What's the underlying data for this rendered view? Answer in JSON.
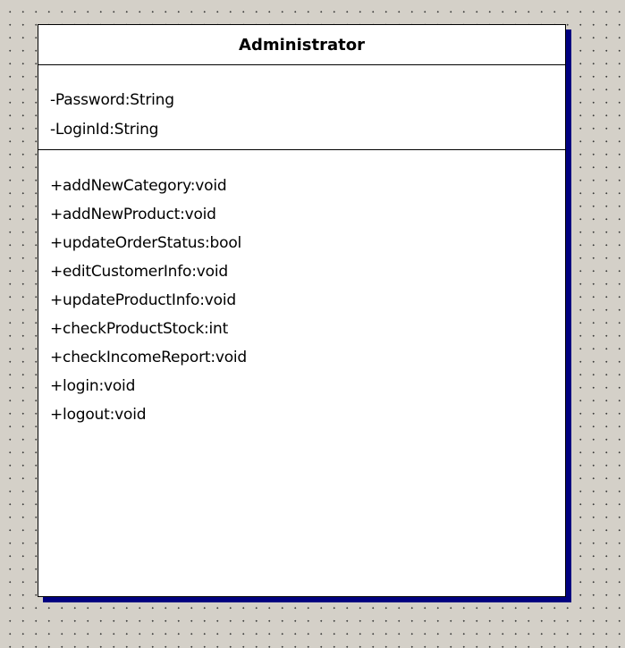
{
  "diagram": {
    "class_name": "Administrator",
    "attributes": [
      "-Password:String",
      "-LoginId:String"
    ],
    "operations": [
      "+addNewCategory:void",
      "+addNewProduct:void",
      "+updateOrderStatus:bool",
      "+editCustomerInfo:void",
      "+updateProductInfo:void",
      "+checkProductStock:int",
      "+checkIncomeReport:void",
      "+login:void",
      "+logout:void"
    ]
  },
  "colors": {
    "canvas_background": "#d4d0c8",
    "grid_dot": "#3c3c3c",
    "box_fill": "#ffffff",
    "box_border": "#000000",
    "shadow": "#000080"
  }
}
